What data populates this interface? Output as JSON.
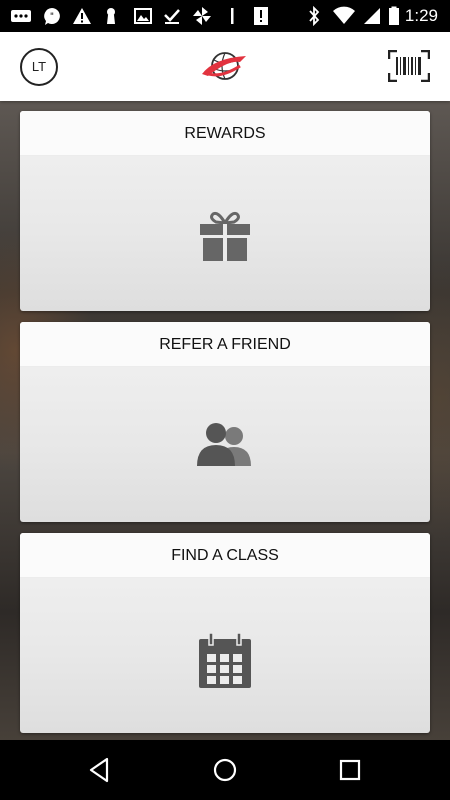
{
  "status_bar": {
    "time": "1:29",
    "icons": [
      "hangouts-icon",
      "chat-bubble-icon",
      "alert-icon",
      "keyhole-icon",
      "image-icon",
      "download-done-icon",
      "pinwheel-icon",
      "vertical-bar-icon",
      "sim-alert-icon",
      "bluetooth-icon",
      "wifi-icon",
      "signal-icon",
      "battery-icon"
    ]
  },
  "header": {
    "avatar_initials": "LT",
    "logo_icon": "globe-swoosh-logo",
    "barcode_icon": "barcode-scan-icon",
    "logo_colors": {
      "swoosh": "#e2333f",
      "globe": "#333333"
    }
  },
  "cards": [
    {
      "title": "REWARDS",
      "icon": "gift-icon"
    },
    {
      "title": "REFER A FRIEND",
      "icon": "people-icon"
    },
    {
      "title": "FIND A CLASS",
      "icon": "calendar-icon"
    }
  ],
  "nav_bar": {
    "buttons": [
      "back-icon",
      "home-icon",
      "recents-icon"
    ]
  },
  "colors": {
    "icon_gray": "#555555",
    "header_bg": "#ffffff",
    "status_bg": "#000000"
  }
}
